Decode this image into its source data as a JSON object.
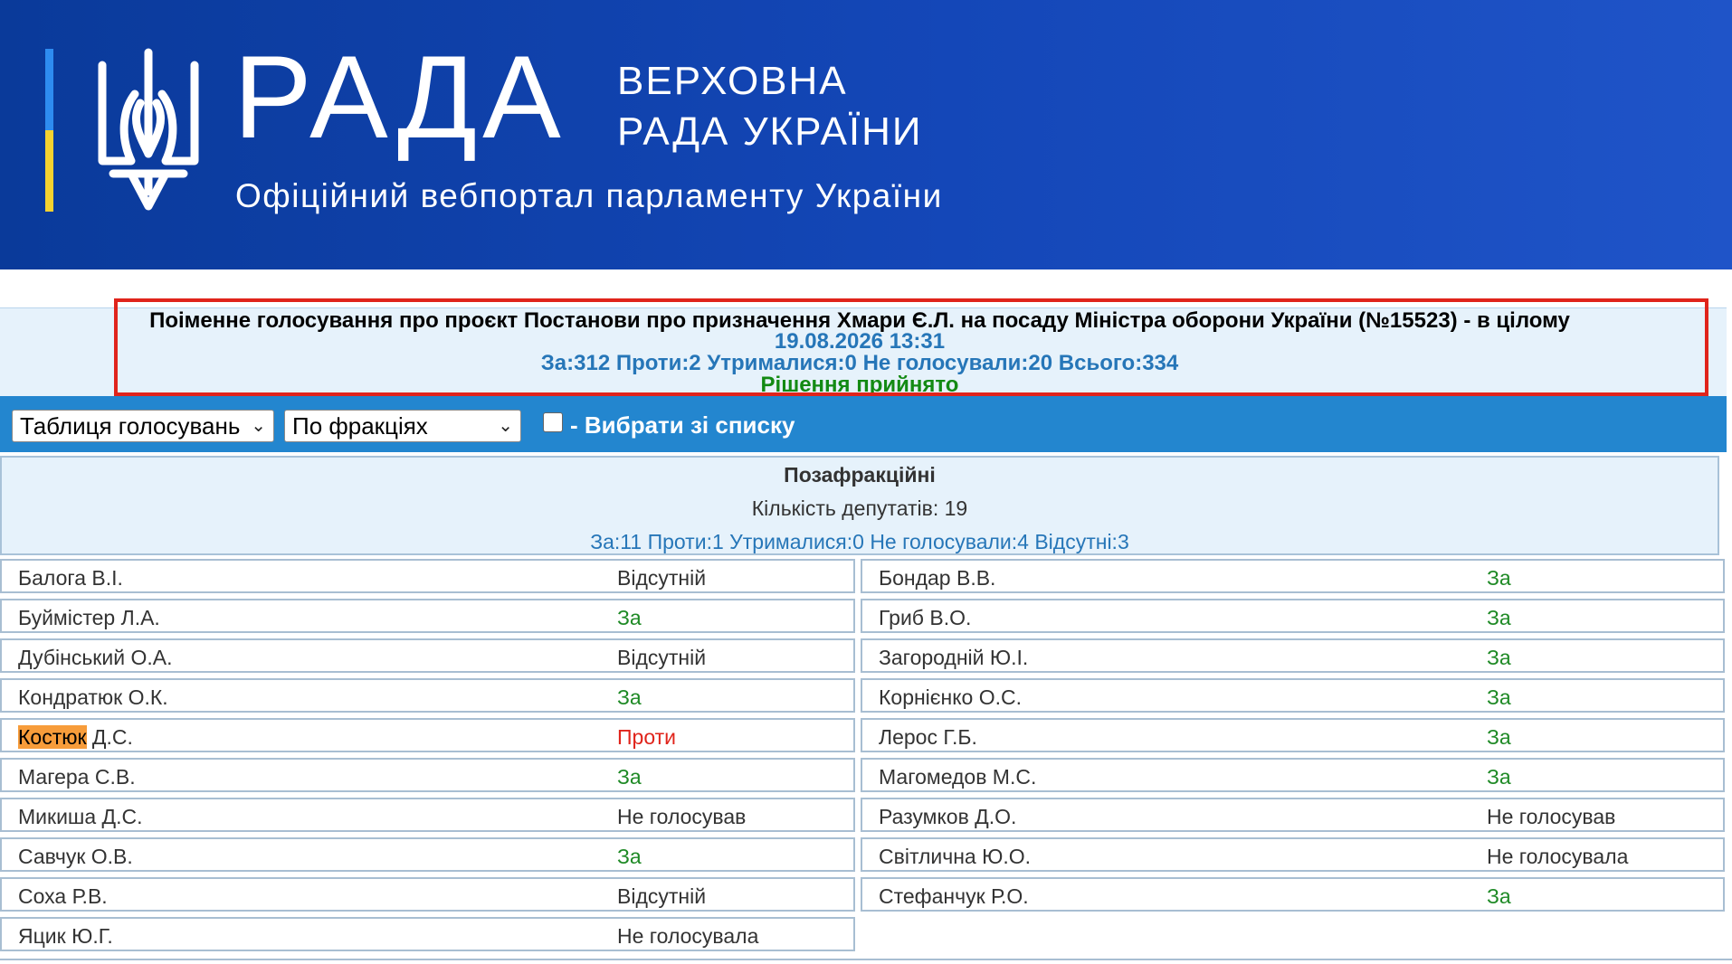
{
  "header": {
    "title": "РАДА",
    "subtitle_line1": "ВЕРХОВНА",
    "subtitle_line2": "РАДА УКРАЇНИ",
    "caption": "Офіційний вебпортал парламенту України",
    "colors": {
      "background": "#1447b8",
      "flag_blue": "#2e8cf0",
      "flag_yellow": "#f5d230"
    }
  },
  "vote": {
    "title": "Поіменне голосування про проєкт Постанови про призначення Хмари Є.Л. на посаду Міністра оборони України (№15523) - в цілому",
    "datetime": "19.08.2026 13:31",
    "totals": "За:312 Проти:2 Утрималися:0 Не голосували:20 Всього:334",
    "decision": "Рішення прийнято"
  },
  "toolbar": {
    "view_select": "Таблиця голосувань",
    "group_select": "По фракціях",
    "checkbox_checked": false,
    "checkbox_label": "- Вибрати зі списку"
  },
  "faction": {
    "name": "Позафракційні",
    "count": "Кількість депутатів: 19",
    "stats": "За:11 Проти:1 Утрималися:0 Не голосували:4 Відсутні:3"
  },
  "deputies_left": [
    {
      "name": "Балога В.І.",
      "vote": "Відсутній",
      "type": "other"
    },
    {
      "name": "Буймістер Л.А.",
      "vote": "За",
      "type": "za"
    },
    {
      "name": "Дубінський О.А.",
      "vote": "Відсутній",
      "type": "other"
    },
    {
      "name": "Кондратюк О.К.",
      "vote": "За",
      "type": "za"
    },
    {
      "name_highlight": "Костюк",
      "name_rest": " Д.С.",
      "vote": "Проти",
      "type": "proty"
    },
    {
      "name": "Магера С.В.",
      "vote": "За",
      "type": "za"
    },
    {
      "name": "Микиша Д.С.",
      "vote": "Не голосував",
      "type": "other"
    },
    {
      "name": "Савчук О.В.",
      "vote": "За",
      "type": "za"
    },
    {
      "name": "Соха Р.В.",
      "vote": "Відсутній",
      "type": "other"
    },
    {
      "name": "Яцик Ю.Г.",
      "vote": "Не голосувала",
      "type": "other"
    }
  ],
  "deputies_right": [
    {
      "name": "Бондар В.В.",
      "vote": "За",
      "type": "za"
    },
    {
      "name": "Гриб В.О.",
      "vote": "За",
      "type": "za"
    },
    {
      "name": "Загородній Ю.І.",
      "vote": "За",
      "type": "za"
    },
    {
      "name": "Корнієнко О.С.",
      "vote": "За",
      "type": "za"
    },
    {
      "name": "Лерос Г.Б.",
      "vote": "За",
      "type": "za"
    },
    {
      "name": "Магомедов М.С.",
      "vote": "За",
      "type": "za"
    },
    {
      "name": "Разумков Д.О.",
      "vote": "Не голосував",
      "type": "other"
    },
    {
      "name": "Світлична Ю.О.",
      "vote": "Не голосувала",
      "type": "other"
    },
    {
      "name": "Стефанчук Р.О.",
      "vote": "За",
      "type": "za"
    }
  ]
}
